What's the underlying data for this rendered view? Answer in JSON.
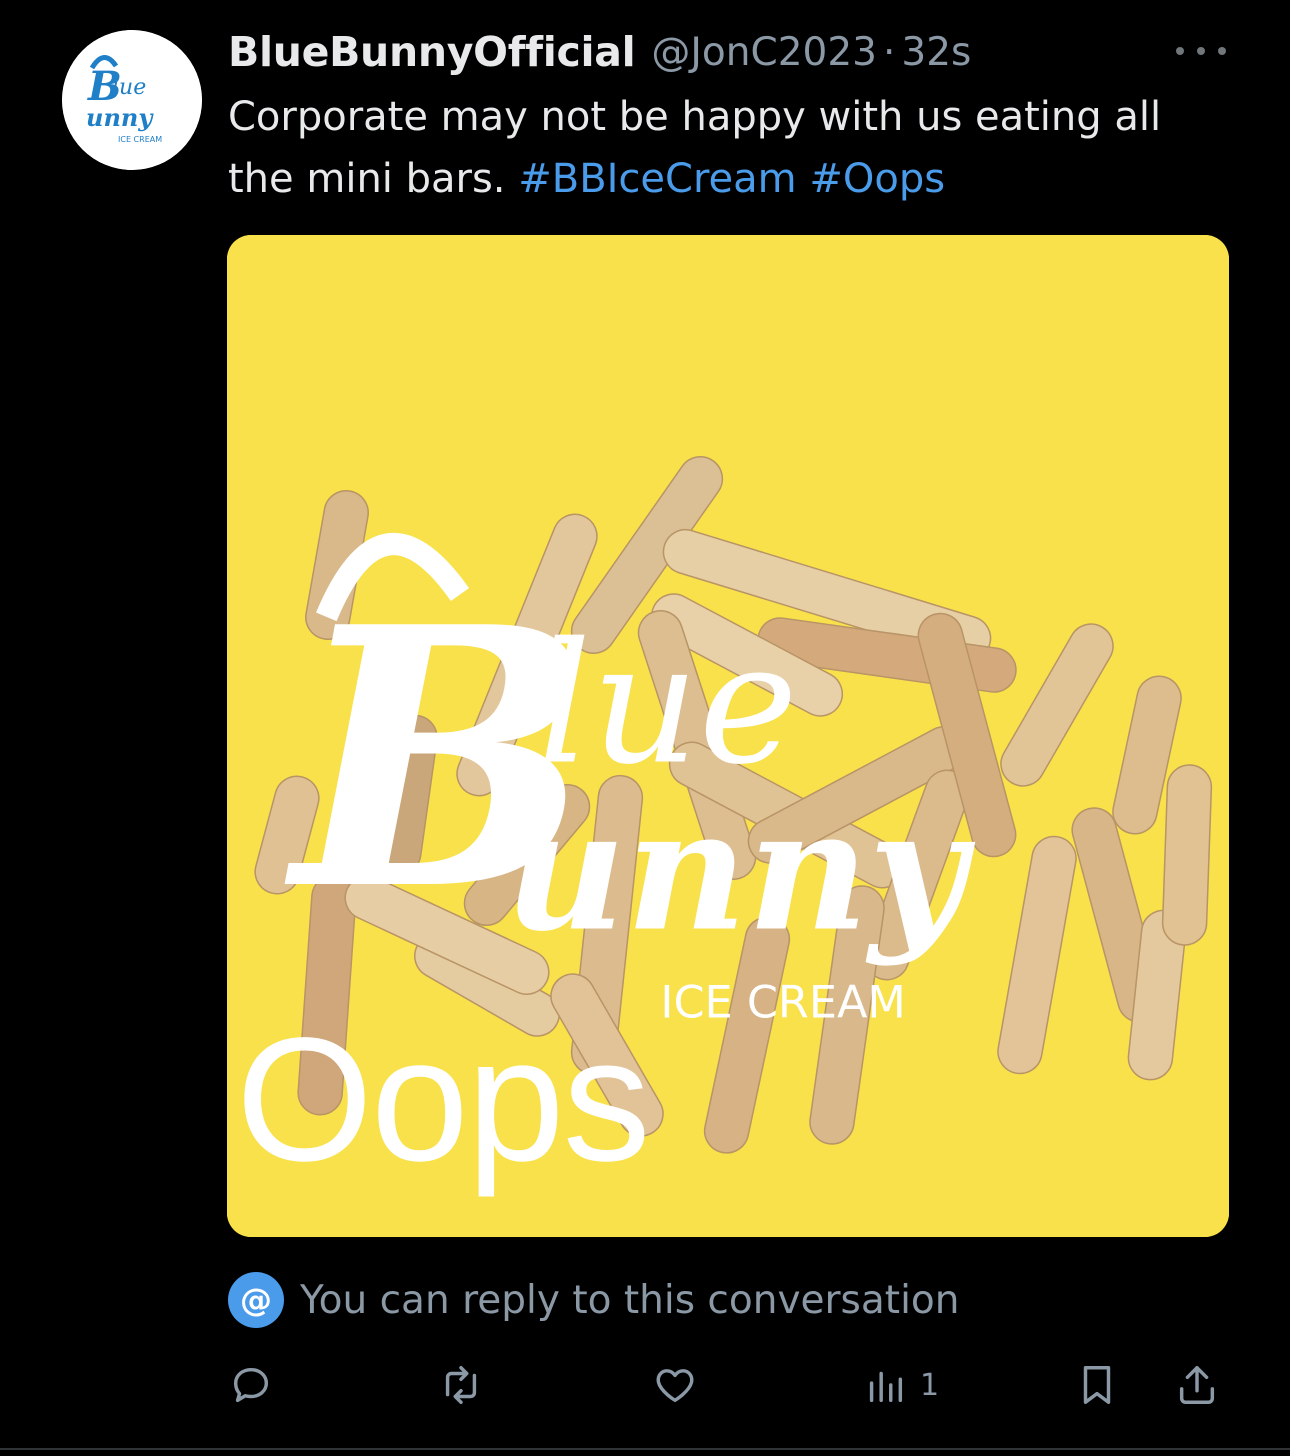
{
  "tweet": {
    "display_name": "BlueBunnyOfficial",
    "handle": "@JonC2023",
    "separator": "·",
    "time": "32s",
    "text_plain": "Corporate may not be happy with us eating all the mini bars. ",
    "hashtags": [
      "#BBIceCream",
      "#Oops"
    ],
    "more_icon": "more-horizontal-icon"
  },
  "avatar": {
    "logo_word1": "Blue",
    "logo_word2": "Bunny",
    "logo_tag": "ICE CREAM"
  },
  "media": {
    "overlay_text": "Oops",
    "logo_word1": "Blue",
    "logo_word2": "Bunny",
    "logo_tag": "ICE CREAM",
    "background_color": "#f8e14a"
  },
  "reply_info": {
    "symbol": "@",
    "text": "You can reply to this conversation"
  },
  "actions": {
    "reply_icon": "reply-icon",
    "retweet_icon": "retweet-icon",
    "like_icon": "heart-icon",
    "views_icon": "analytics-icon",
    "views_count": "1",
    "bookmark_icon": "bookmark-icon",
    "share_icon": "share-icon"
  },
  "colors": {
    "accent": "#4a9bea",
    "text": "#e7e9ea",
    "muted": "#8b98a5",
    "background": "#000000"
  }
}
